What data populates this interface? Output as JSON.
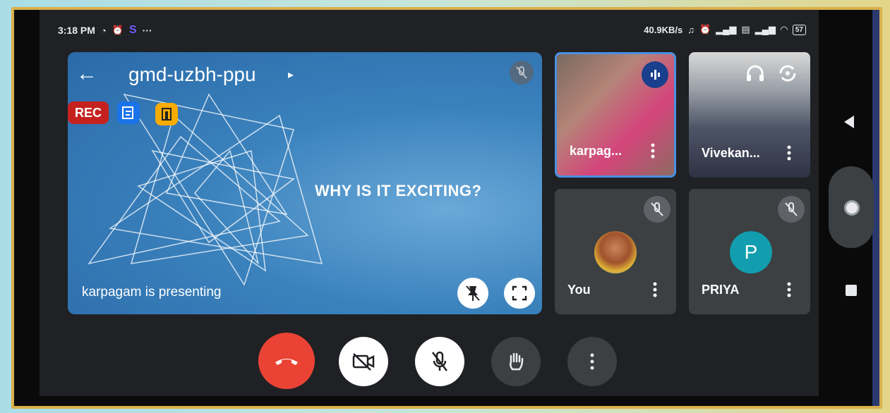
{
  "status_bar": {
    "time": "3:18 PM",
    "brand_glyph": "S",
    "more": "···",
    "network_speed": "40.9KB/s",
    "battery": "57"
  },
  "meeting": {
    "code": "gmd-uzbh-ppu",
    "rec_label": "REC",
    "presenting_text": "karpagam is presenting",
    "slide_text": "WHY IS IT EXCITING?"
  },
  "participants": [
    {
      "name": "karpag...",
      "state": "speaking"
    },
    {
      "name": "Vivekan...",
      "state": "camera-on"
    },
    {
      "name": "You",
      "state": "muted"
    },
    {
      "name": "PRIYA",
      "state": "muted",
      "initial": "P"
    }
  ],
  "colors": {
    "end_call": "#ea4335",
    "rec_badge": "#c5221f",
    "avatar_p": "#129eaf",
    "speaking_highlight": "#4a90e2"
  }
}
